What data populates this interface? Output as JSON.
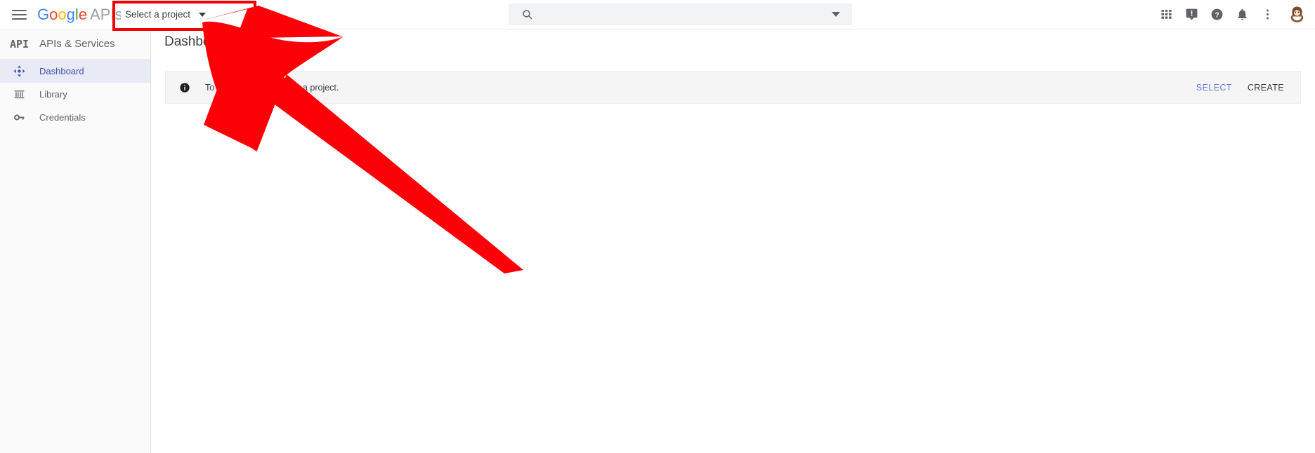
{
  "header": {
    "menu_icon": "hamburger-menu-icon",
    "brand": {
      "g": "G",
      "o1": "o",
      "o2": "o",
      "g2": "g",
      "l": "l",
      "e": "e",
      "suffix": "APIs"
    },
    "project_button": {
      "label": "Select a project",
      "caret_icon": "chevron-down-icon"
    },
    "search": {
      "icon": "search-icon",
      "value": "",
      "placeholder": "",
      "caret_icon": "chevron-down-icon"
    },
    "icons": [
      {
        "name": "apps-grid-icon",
        "title": "Google apps"
      },
      {
        "name": "feedback-icon",
        "title": "Send feedback"
      },
      {
        "name": "help-icon",
        "title": "Help"
      },
      {
        "name": "notifications-bell-icon",
        "title": "Notifications"
      },
      {
        "name": "more-options-icon",
        "title": "More options"
      }
    ],
    "avatar": {
      "name": "user-avatar",
      "title": "Account"
    }
  },
  "sidebar": {
    "logo_text": "API",
    "title": "APIs & Services",
    "items": [
      {
        "label": "Dashboard",
        "icon": "dashboard-icon",
        "active": true
      },
      {
        "label": "Library",
        "icon": "library-icon",
        "active": false
      },
      {
        "label": "Credentials",
        "icon": "key-icon",
        "active": false
      }
    ]
  },
  "main": {
    "page_title": "Dashboard",
    "banner": {
      "icon": "info-icon",
      "text": "To view this page, select a project.",
      "select_label": "SELECT",
      "create_label": "CREATE"
    }
  },
  "annotation": {
    "highlight_color": "#f10000",
    "arrow_color": "#fb0007",
    "target": "Select a project"
  }
}
